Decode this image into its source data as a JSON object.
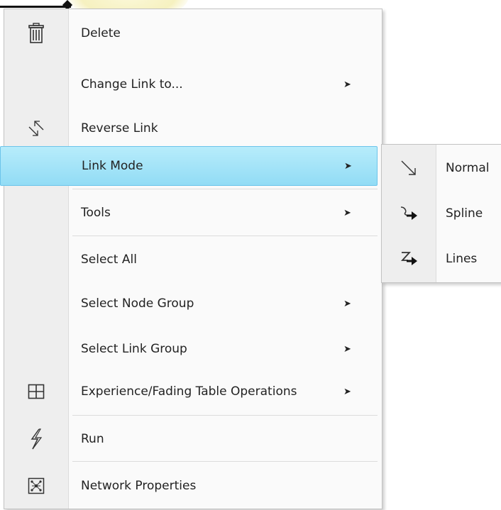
{
  "menu": {
    "items": [
      {
        "label": "Delete",
        "icon": "trash-icon",
        "has_submenu": false
      },
      {
        "label": "Change Link to...",
        "icon": "",
        "has_submenu": true
      },
      {
        "label": "Reverse Link",
        "icon": "reverse-link-icon",
        "has_submenu": false
      },
      {
        "label": "Link Mode",
        "icon": "",
        "has_submenu": true,
        "highlighted": true
      },
      {
        "label": "Tools",
        "icon": "",
        "has_submenu": true
      },
      {
        "label": "Select All",
        "icon": "",
        "has_submenu": false
      },
      {
        "label": "Select Node Group",
        "icon": "",
        "has_submenu": true
      },
      {
        "label": "Select Link Group",
        "icon": "",
        "has_submenu": true
      },
      {
        "label": "Experience/Fading Table Operations",
        "icon": "table-icon",
        "has_submenu": true
      },
      {
        "label": "Run",
        "icon": "lightning-icon",
        "has_submenu": false
      },
      {
        "label": "Network Properties",
        "icon": "network-icon",
        "has_submenu": false
      }
    ],
    "submenu_arrow": "➤"
  },
  "submenu": {
    "items": [
      {
        "label": "Normal",
        "icon": "normal-link-icon"
      },
      {
        "label": "Spline",
        "icon": "spline-link-icon"
      },
      {
        "label": "Lines",
        "icon": "lines-link-icon"
      }
    ]
  },
  "colors": {
    "highlight": "#a5e4f8",
    "highlight_border": "#6cc4ea",
    "menu_bg": "#fafafa",
    "gutter_bg": "#eeeeee"
  }
}
